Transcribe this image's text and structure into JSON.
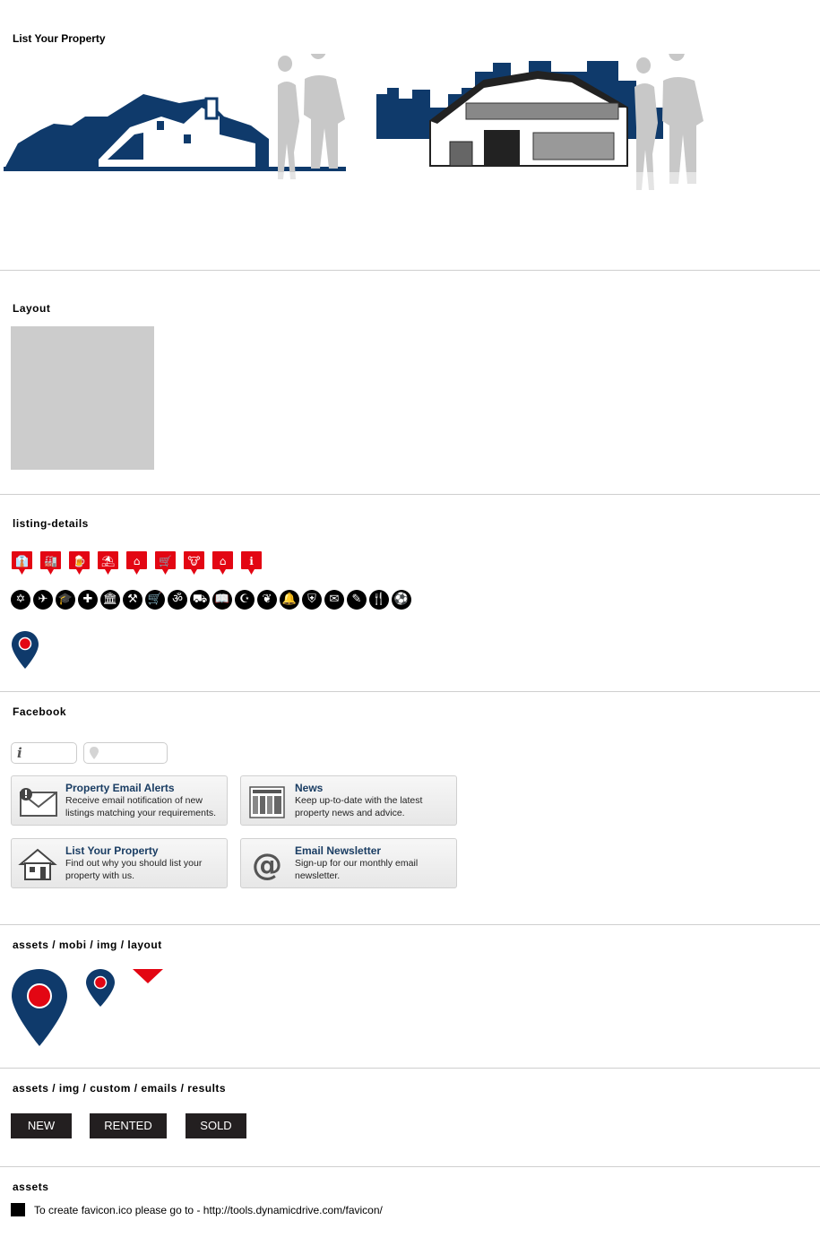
{
  "sections": {
    "list_property": "List Your Property",
    "layout": "Layout",
    "listing_details": "listing-details",
    "facebook": "Facebook",
    "mobi_layout": "assets / mobi / img / layout",
    "emails_results": "assets / img / custom / emails / results",
    "assets": "assets"
  },
  "hero": {
    "left_scene": "suburban-house-with-silhouettes",
    "right_scene": "office-building-with-silhouettes",
    "colors": {
      "navy": "#0f3a6b",
      "silhouette": "#c8c8c8"
    }
  },
  "listing_details": {
    "red_pin_icons": [
      "tie-icon",
      "factory-icon",
      "pub-icon",
      "beach-icon",
      "home-icon",
      "shopping-cart-icon",
      "cow-icon",
      "house-badge-icon",
      "info-icon"
    ],
    "circle_icons": [
      {
        "name": "star-of-david-icon",
        "glyph": "✡"
      },
      {
        "name": "airplane-icon",
        "glyph": "✈"
      },
      {
        "name": "graduation-cap-icon",
        "glyph": "🎓"
      },
      {
        "name": "cross-icon",
        "glyph": "✚"
      },
      {
        "name": "bank-icon",
        "glyph": "🏛"
      },
      {
        "name": "gavel-icon",
        "glyph": "⚒"
      },
      {
        "name": "shopping-cart-icon",
        "glyph": "🛒"
      },
      {
        "name": "om-icon",
        "glyph": "ॐ"
      },
      {
        "name": "truck-icon",
        "glyph": "⛟"
      },
      {
        "name": "book-icon",
        "glyph": "📖"
      },
      {
        "name": "crescent-icon",
        "glyph": "☪"
      },
      {
        "name": "leaf-icon",
        "glyph": "❦"
      },
      {
        "name": "bell-icon",
        "glyph": "🔔"
      },
      {
        "name": "shield-icon",
        "glyph": "⛨"
      },
      {
        "name": "envelope-icon",
        "glyph": "✉"
      },
      {
        "name": "pencil-icon",
        "glyph": "✎"
      },
      {
        "name": "cutlery-icon",
        "glyph": "🍴"
      },
      {
        "name": "soccer-ball-icon",
        "glyph": "⚽"
      }
    ],
    "pin_colors": {
      "red": "#e30613",
      "navy": "#0f3a6b"
    }
  },
  "facebook": {
    "cards": [
      {
        "title": "Property Email Alerts",
        "desc": "Receive email notification of new listings matching your requirements.",
        "icon": "email-alert-icon"
      },
      {
        "title": "News",
        "desc": "Keep up-to-date with the latest property news and advice.",
        "icon": "newspaper-icon"
      },
      {
        "title": "List Your Property",
        "desc": "Find out why you should list your property with us.",
        "icon": "house-icon"
      },
      {
        "title": "Email Newsletter",
        "desc": "Sign-up for our monthly email newsletter.",
        "icon": "at-sign-icon"
      }
    ],
    "card_title_color": "#1a3d63"
  },
  "results": {
    "new": "NEW",
    "rented": "RENTED",
    "sold": "SOLD"
  },
  "assets": {
    "favicon_note": "To create favicon.ico please go to - http://tools.dynamicdrive.com/favicon/"
  }
}
